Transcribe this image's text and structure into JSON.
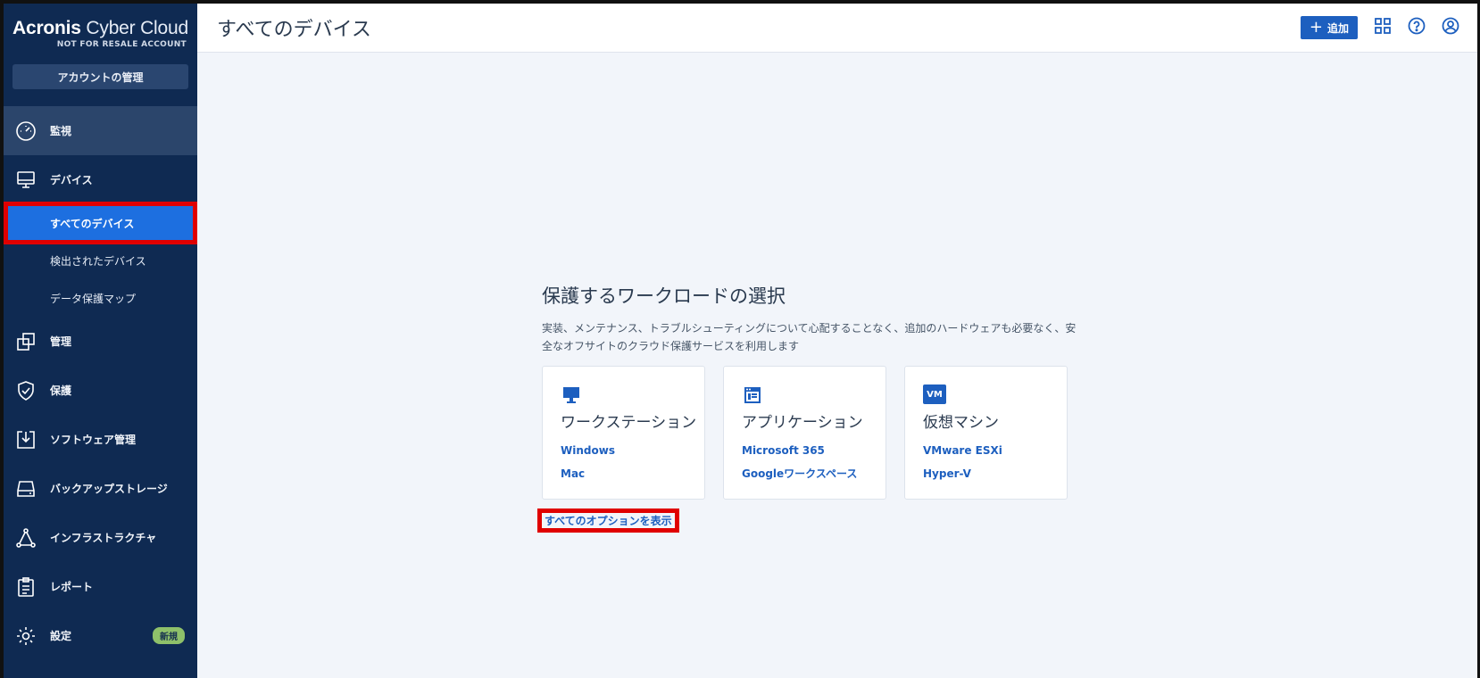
{
  "brand": {
    "name_bold": "Acronis",
    "name_light": " Cyber Cloud",
    "subtitle": "NOT FOR RESALE ACCOUNT"
  },
  "sidebar": {
    "account_button": "アカウントの管理",
    "items": [
      {
        "label": "監視",
        "icon": "gauge-icon"
      },
      {
        "label": "デバイス",
        "icon": "monitor-icon"
      },
      {
        "label": "管理",
        "icon": "copy-squares-icon"
      },
      {
        "label": "保護",
        "icon": "shield-check-icon"
      },
      {
        "label": "ソフトウェア管理",
        "icon": "download-box-icon"
      },
      {
        "label": "バックアップストレージ",
        "icon": "hard-drive-icon"
      },
      {
        "label": "インフラストラクチャ",
        "icon": "network-triangle-icon"
      },
      {
        "label": "レポート",
        "icon": "clipboard-icon"
      },
      {
        "label": "設定",
        "icon": "gear-icon",
        "badge": "新規"
      }
    ],
    "device_subitems": [
      {
        "label": "すべてのデバイス",
        "selected": true
      },
      {
        "label": "検出されたデバイス"
      },
      {
        "label": "データ保護マップ"
      }
    ]
  },
  "header": {
    "title": "すべてのデバイス",
    "add_label": "追加",
    "accent": "#1d5fbf"
  },
  "main": {
    "heading": "保護するワークロードの選択",
    "description": "実装、メンテナンス、トラブルシューティングについて心配することなく、追加のハードウェアも必要なく、安全なオフサイトのクラウド保護サービスを利用します",
    "cards": [
      {
        "title": "ワークステーション",
        "icon": "desktop-icon",
        "links": [
          "Windows",
          "Mac"
        ]
      },
      {
        "title": "アプリケーション",
        "icon": "app-window-icon",
        "links": [
          "Microsoft 365",
          "Googleワークスペース"
        ]
      },
      {
        "title": "仮想マシン",
        "icon": "vm-icon",
        "icon_text": "VM",
        "links": [
          "VMware ESXi",
          "Hyper-V"
        ]
      }
    ],
    "all_options_link": "すべてのオプションを表示"
  },
  "colors": {
    "sidebar_bg": "#0f2a52",
    "selected_bg": "#1d6fe0",
    "highlight": "#e00000",
    "badge_bg": "#8ec06a"
  }
}
